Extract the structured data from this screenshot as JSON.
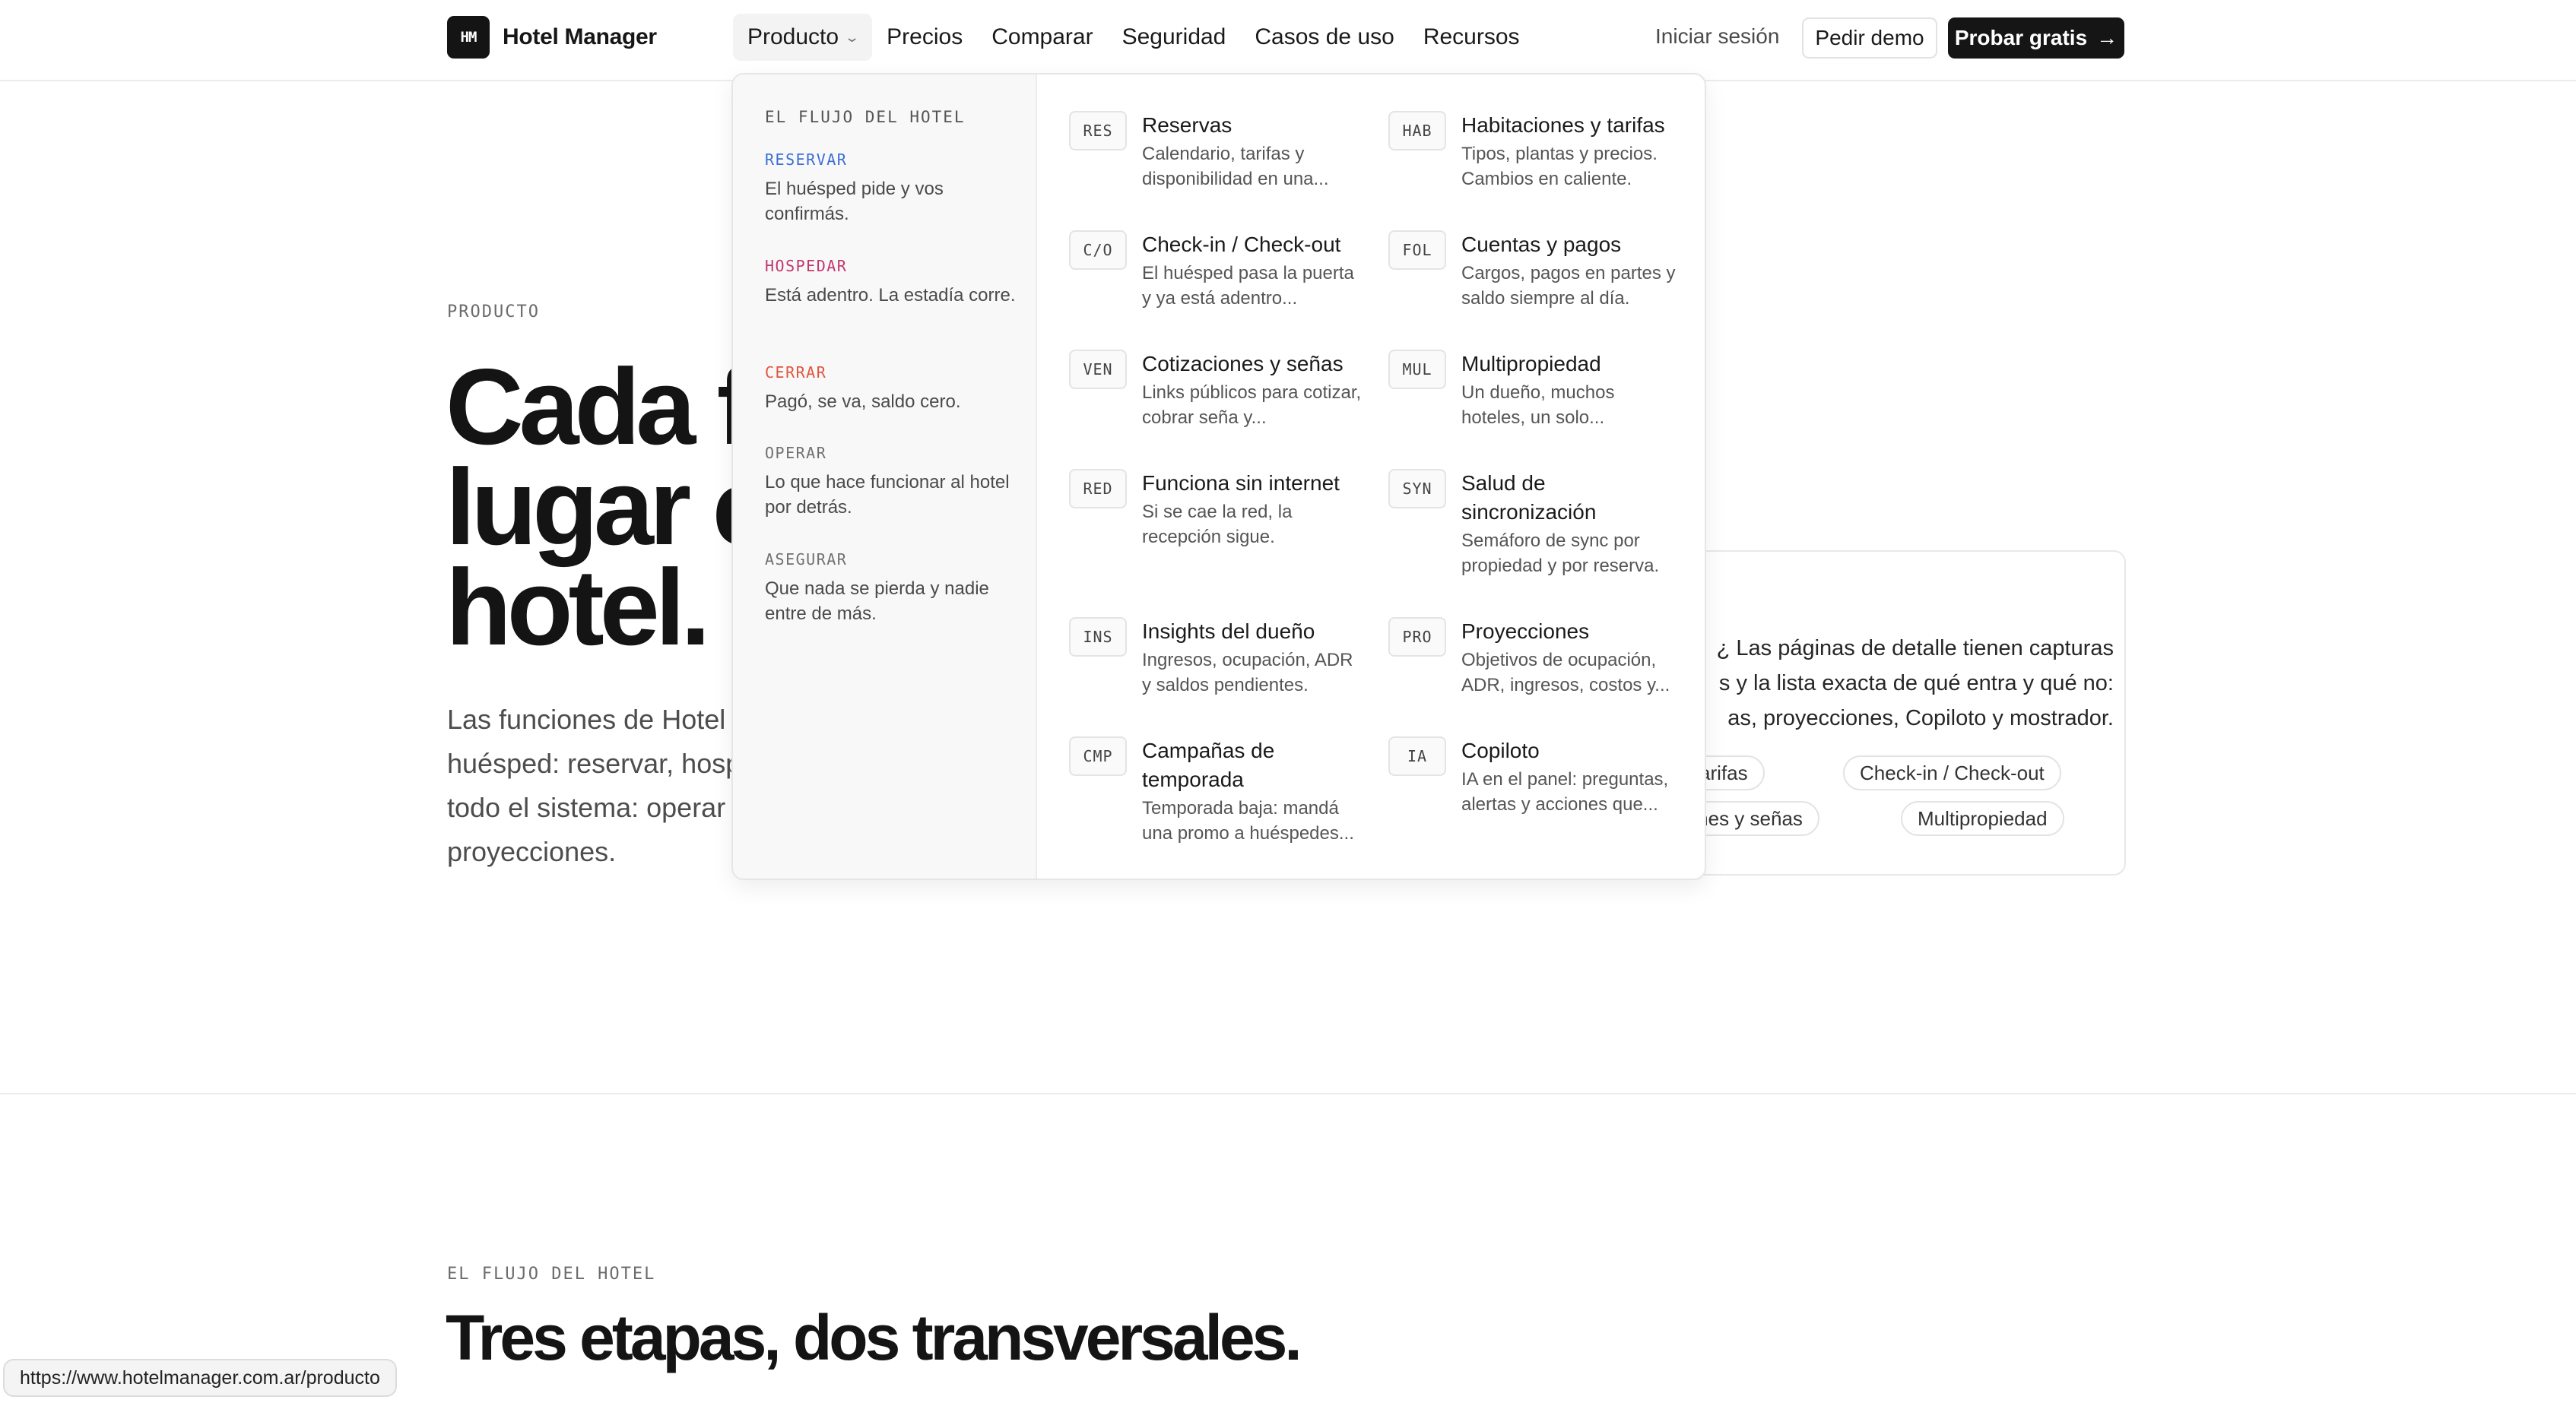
{
  "header": {
    "logo_mark": "HM",
    "logo_text": "Hotel Manager",
    "nav": [
      "Producto",
      "Precios",
      "Comparar",
      "Seguridad",
      "Casos de uso",
      "Recursos"
    ],
    "login": "Iniciar sesión",
    "demo": "Pedir demo",
    "try": "Probar gratis",
    "try_arrow": "→"
  },
  "hero": {
    "eyebrow": "PRODUCTO",
    "title_lines": [
      "Cada fu",
      "lugar e",
      "hotel."
    ],
    "desc_lines": [
      "Las funciones de Hotel",
      "huésped: reservar, hosp",
      "todo el sistema: operar",
      "proyecciones."
    ]
  },
  "card": {
    "text_lines": [
      "¿ Las páginas de detalle tienen capturas",
      "s y la lista exacta de qué entra y qué no:",
      "as, proyecciones, Copiloto y mostrador."
    ],
    "chips": [
      "ones y tarifas",
      "Check-in / Check-out",
      "otizaciones y señas",
      "Multipropiedad"
    ]
  },
  "dropdown": {
    "left_title": "EL FLUJO DEL HOTEL",
    "flow": [
      {
        "label": "RESERVAR",
        "desc": "El huésped pide y vos confirmás.",
        "color": "#3b6fd6"
      },
      {
        "label": "HOSPEDAR",
        "desc": "Está adentro. La estadía corre.",
        "color": "#c2366f"
      },
      {
        "label": "CERRAR",
        "desc": "Pagó, se va, saldo cero.",
        "color": "#e0563d"
      },
      {
        "label": "OPERAR",
        "desc": "Lo que hace funcionar al hotel por detrás.",
        "color": "#707070"
      },
      {
        "label": "ASEGURAR",
        "desc": "Que nada se pierda y nadie entre de más.",
        "color": "#707070"
      }
    ],
    "features": [
      {
        "code": "RES",
        "title": "Reservas",
        "desc": "Calendario, tarifas y disponibilidad en una..."
      },
      {
        "code": "HAB",
        "title": "Habitaciones y tarifas",
        "desc": "Tipos, plantas y precios. Cambios en caliente."
      },
      {
        "code": "C/O",
        "title": "Check-in / Check-out",
        "desc": "El huésped pasa la puerta y ya está adentro..."
      },
      {
        "code": "FOL",
        "title": "Cuentas y pagos",
        "desc": "Cargos, pagos en partes y saldo siempre al día."
      },
      {
        "code": "VEN",
        "title": "Cotizaciones y señas",
        "desc": "Links públicos para cotizar, cobrar seña y..."
      },
      {
        "code": "MUL",
        "title": "Multipropiedad",
        "desc": "Un dueño, muchos hoteles, un solo..."
      },
      {
        "code": "RED",
        "title": "Funciona sin internet",
        "desc": "Si se cae la red, la recepción sigue."
      },
      {
        "code": "SYN",
        "title": "Salud de sincronización",
        "desc": "Semáforo de sync por propiedad y por reserva."
      },
      {
        "code": "INS",
        "title": "Insights del dueño",
        "desc": "Ingresos, ocupación, ADR y saldos pendientes."
      },
      {
        "code": "PRO",
        "title": "Proyecciones",
        "desc": "Objetivos de ocupación, ADR, ingresos, costos y..."
      },
      {
        "code": "CMP",
        "title": "Campañas de temporada",
        "desc": "Temporada baja: mandá una promo a huéspedes..."
      },
      {
        "code": "IA",
        "title": "Copiloto",
        "desc": "IA en el panel: preguntas, alertas y acciones que..."
      }
    ]
  },
  "section": {
    "eyebrow": "EL FLUJO DEL HOTEL",
    "title": "Tres etapas, dos transversales."
  },
  "status_url": "https://www.hotelmanager.com.ar/producto"
}
